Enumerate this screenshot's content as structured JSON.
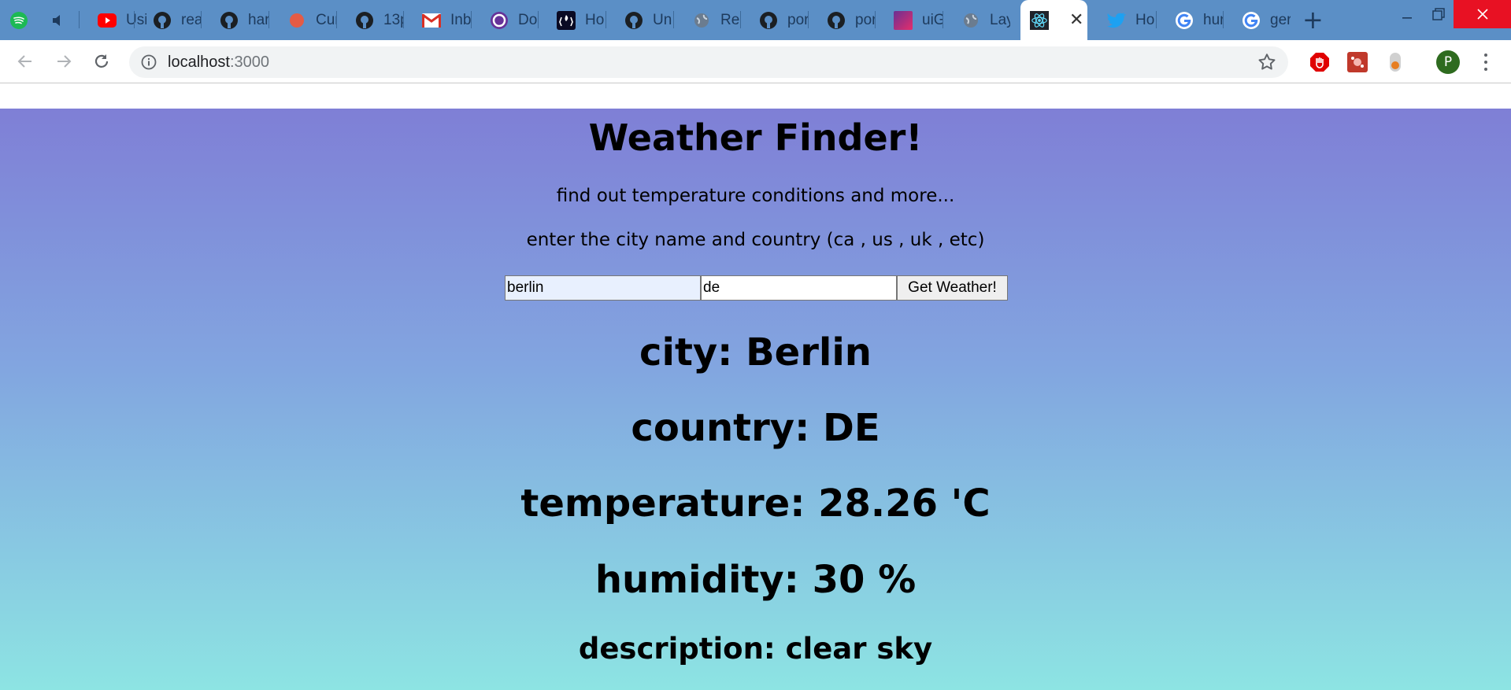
{
  "browser": {
    "tabs": [
      {
        "title": "",
        "icon": "spotify-icon",
        "color": "#1db954"
      },
      {
        "title": "",
        "icon": "muted-speaker-icon",
        "color": "#1d3a5c"
      },
      {
        "title": "Usi",
        "icon": "youtube-icon",
        "color": "#ff0000"
      },
      {
        "title": "rea",
        "icon": "github-icon",
        "color": "#1b1f23"
      },
      {
        "title": "har",
        "icon": "github-icon",
        "color": "#1b1f23"
      },
      {
        "title": "Cur",
        "icon": "curious-icon",
        "color": "#e45b45"
      },
      {
        "title": "13p",
        "icon": "github-icon",
        "color": "#1b1f23"
      },
      {
        "title": "Inb",
        "icon": "gmail-icon",
        "color": "#d93025"
      },
      {
        "title": "Do",
        "icon": "gatsby-icon",
        "color": "#663399"
      },
      {
        "title": "Ho",
        "icon": "freecodecamp-icon",
        "color": "#0a0a23"
      },
      {
        "title": "Un",
        "icon": "github-icon",
        "color": "#1b1f23"
      },
      {
        "title": "Rea",
        "icon": "globe-icon",
        "color": "#5f6368"
      },
      {
        "title": "por",
        "icon": "github-icon",
        "color": "#1b1f23"
      },
      {
        "title": "por",
        "icon": "github-icon",
        "color": "#1b1f23"
      },
      {
        "title": "uiG",
        "icon": "uigradients-icon",
        "color": "#c2185b"
      },
      {
        "title": "Lay",
        "icon": "globe-icon",
        "color": "#5f6368"
      },
      {
        "title": "",
        "icon": "react-icon",
        "color": "#61dafb"
      },
      {
        "title": "Ho",
        "icon": "twitter-icon",
        "color": "#1da1f2"
      },
      {
        "title": "hur",
        "icon": "google-icon",
        "color": "#4285f4"
      },
      {
        "title": "ger",
        "icon": "google-icon",
        "color": "#4285f4"
      }
    ],
    "address": {
      "host": "localhost",
      "port": ":3000"
    },
    "profile_initial": "P"
  },
  "app": {
    "title": "Weather Finder!",
    "subtitle": "find out temperature conditions and more...",
    "instruction": "enter the city name and country (ca , us , uk , etc)",
    "form": {
      "city_value": "berlin",
      "country_value": "de",
      "submit_label": "Get Weather!"
    },
    "results": {
      "city": "city: Berlin",
      "country": "country: DE",
      "temperature": "temperature: 28.26 'C",
      "humidity": "humidity: 30 %",
      "description": "description: clear sky"
    }
  }
}
